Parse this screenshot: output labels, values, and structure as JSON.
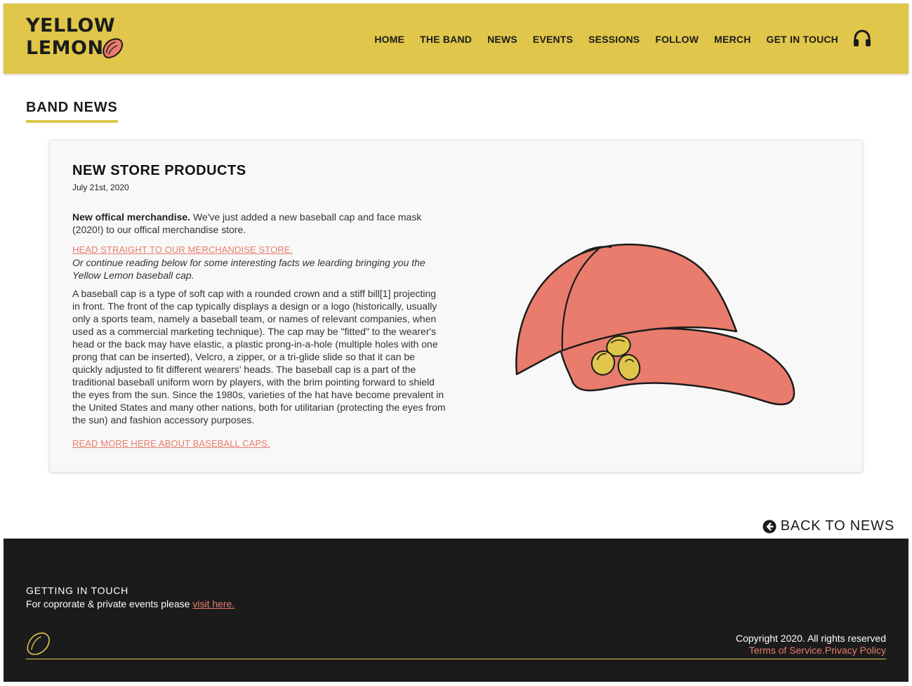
{
  "brand": {
    "line1": "YELLOW",
    "line2": "LEMON",
    "accent_color": "#e0c64a",
    "link_color": "#e97c6c"
  },
  "nav": {
    "items": [
      "HOME",
      "THE BAND",
      "NEWS",
      "EVENTS",
      "SESSIONS",
      "FOLLOW",
      "MERCH",
      "GET IN TOUCH"
    ],
    "icon": "headphones-icon"
  },
  "section": {
    "title": "BAND NEWS"
  },
  "article": {
    "title": "NEW STORE PRODUCTS",
    "date": "July 21st, 2020",
    "lead_bold": "New offical merchandise.",
    "lead_rest": " We've just added a new baseball cap and face mask (2020!) to our offical merchandise store.",
    "store_link": "HEAD STRAIGHT TO OUR MERCHANDISE STORE.",
    "italic_text": "Or continue reading below for some interesting facts we learding bringing you the Yellow Lemon baseball cap.",
    "body": "A baseball cap is a type of soft cap with a rounded crown and a stiff bill[1] projecting in front. The front of the cap typically displays a design or a logo (historically, usually only a sports team, namely a baseball team, or names of relevant companies, when used as a commercial marketing technique). The cap may be \"fitted\" to the wearer's head or the back may have elastic, a plastic prong-in-a-hole (multiple holes with one prong that can be inserted), Velcro, a zipper, or a tri-glide slide so that it can be quickly adjusted to fit different wearers' heads. The baseball cap is a part of the traditional baseball uniform worn by players, with the brim pointing forward to shield the eyes from the sun. Since the 1980s, varieties of the hat have become prevalent in the United States and many other nations, both for utilitarian (protecting the eyes from the sun) and fashion accessory purposes.",
    "more_link": "READ MORE HERE ABOUT BASEBALL CAPS.",
    "image": "baseball-cap-illustration"
  },
  "back": {
    "label": "BACK TO NEWS",
    "icon": "arrow-circle-left-icon"
  },
  "footer": {
    "heading": "GETTING IN TOUCH",
    "text": "For coprorate & private events please ",
    "link": "visit here.",
    "copyright": "Copyright 2020. All rights reserved",
    "terms": "Terms of Service.",
    "privacy": "Privacy Policy"
  }
}
